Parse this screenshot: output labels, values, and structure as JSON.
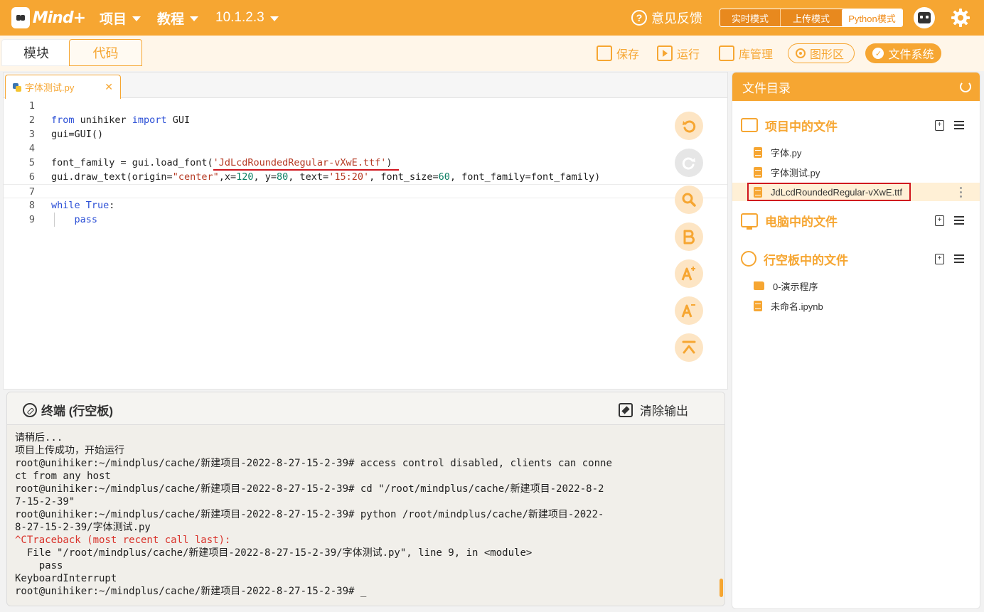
{
  "app": {
    "brand": "Mind+",
    "menus": [
      {
        "label": "项目"
      },
      {
        "label": "教程"
      },
      {
        "label": "10.1.2.3"
      }
    ],
    "feedback_label": "意见反馈",
    "modes": {
      "realtime": "实时模式",
      "upload": "上传模式",
      "python": "Python模式",
      "active": "Python模式"
    },
    "accent_color": "#f6a632"
  },
  "subbar": {
    "tab_blocks": "模块",
    "tab_code": "代码",
    "save_label": "保存",
    "run_label": "运行",
    "libs_label": "库管理",
    "graph_label": "图形区",
    "fs_label": "文件系统"
  },
  "editor": {
    "tab_name": "字体测试.py",
    "close_glyph": "✕",
    "line_numbers": [
      "1",
      "2",
      "3",
      "4",
      "5",
      "6",
      "7",
      "8",
      "9"
    ]
  },
  "terminal": {
    "title": "终端 (行空板)",
    "clear_label": "清除输出",
    "lines": [
      "请稍后...",
      "项目上传成功，开始运行",
      "root@unihiker:~/mindplus/cache/新建项目-2022-8-27-15-2-39# access control disabled, clients can conne",
      "ct from any host",
      "root@unihiker:~/mindplus/cache/新建项目-2022-8-27-15-2-39# cd \"/root/mindplus/cache/新建项目-2022-8-2",
      "7-15-2-39\"",
      "root@unihiker:~/mindplus/cache/新建项目-2022-8-27-15-2-39# python /root/mindplus/cache/新建项目-2022-",
      "8-27-15-2-39/字体测试.py",
      "^CTraceback (most recent call last):",
      "  File \"/root/mindplus/cache/新建项目-2022-8-27-15-2-39/字体测试.py\", line 9, in <module>",
      "    pass",
      "KeyboardInterrupt",
      "root@unihiker:~/mindplus/cache/新建项目-2022-8-27-15-2-39# _"
    ]
  },
  "files": {
    "header": "文件目录",
    "project_section": "项目中的文件",
    "project_files": [
      "字体.py",
      "字体测试.py",
      "JdLcdRoundedRegular-vXwE.ttf"
    ],
    "selected_file": "JdLcdRoundedRegular-vXwE.ttf",
    "pc_section": "电脑中的文件",
    "board_section": "行空板中的文件",
    "board_files": [
      {
        "name": "0-演示程序",
        "kind": "folder"
      },
      {
        "name": "未命名.ipynb",
        "kind": "file"
      }
    ]
  }
}
